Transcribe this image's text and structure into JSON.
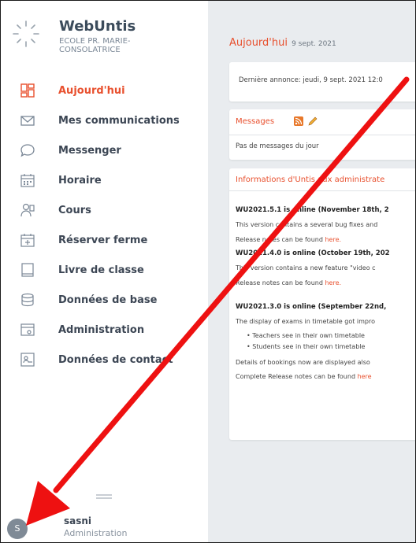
{
  "app": {
    "name": "WebUntis",
    "school": "ECOLE PR. MARIE-CONSOLATRICE"
  },
  "nav": [
    {
      "id": "today",
      "label": "Aujourd'hui",
      "icon": "dashboard-icon",
      "active": true
    },
    {
      "id": "communications",
      "label": "Mes communications",
      "icon": "envelope-icon",
      "active": false
    },
    {
      "id": "messenger",
      "label": "Messenger",
      "icon": "chat-bubble-icon",
      "active": false
    },
    {
      "id": "timetable",
      "label": "Horaire",
      "icon": "calendar-grid-icon",
      "active": false
    },
    {
      "id": "courses",
      "label": "Cours",
      "icon": "student-icon",
      "active": false
    },
    {
      "id": "booking",
      "label": "Réserver ferme",
      "icon": "calendar-plus-icon",
      "active": false
    },
    {
      "id": "classbook",
      "label": "Livre de classe",
      "icon": "book-icon",
      "active": false
    },
    {
      "id": "masterdata",
      "label": "Données de base",
      "icon": "database-icon",
      "active": false
    },
    {
      "id": "admin",
      "label": "Administration",
      "icon": "settings-window-icon",
      "active": false
    },
    {
      "id": "contacts",
      "label": "Données de contact",
      "icon": "contact-card-icon",
      "active": false
    }
  ],
  "user": {
    "initial": "S",
    "name": "sasni",
    "role": "Administration"
  },
  "main": {
    "title": "Aujourd'hui",
    "date": "9 sept. 2021",
    "announcement": "Dernière annonce: jeudi, 9 sept. 2021 12:0",
    "messages": {
      "title": "Messages",
      "empty": "Pas de messages du jour"
    },
    "info": {
      "title": "Informations d'Untis aux administrate",
      "items": [
        {
          "kind": "h",
          "text": "WU2021.5.1 is online (November 18th, 2"
        },
        {
          "kind": "p",
          "text": "This version contains a several bug fixes and"
        },
        {
          "kind": "p",
          "text": "Release notes can be found ",
          "link": "here."
        },
        {
          "kind": "h",
          "text": "WU2021.4.0 is online (October 19th, 202"
        },
        {
          "kind": "p",
          "text": "This version contains a new feature \"video c"
        },
        {
          "kind": "p",
          "text": "Release notes can be found ",
          "link": "here."
        },
        {
          "kind": "h",
          "text": "WU2021.3.0 is online (September 22nd,"
        },
        {
          "kind": "p",
          "text": "The display of exams in timetable got impro"
        },
        {
          "kind": "b",
          "text": "Teachers see in their own timetable"
        },
        {
          "kind": "b",
          "text": "Students see in their own timetable"
        },
        {
          "kind": "p",
          "text": "Details of bookings now are displayed also"
        },
        {
          "kind": "p",
          "text": "Complete Release notes can be found ",
          "link": "here"
        }
      ]
    }
  },
  "colors": {
    "accent": "#e8502e",
    "annotation_arrow": "#ee1111"
  }
}
